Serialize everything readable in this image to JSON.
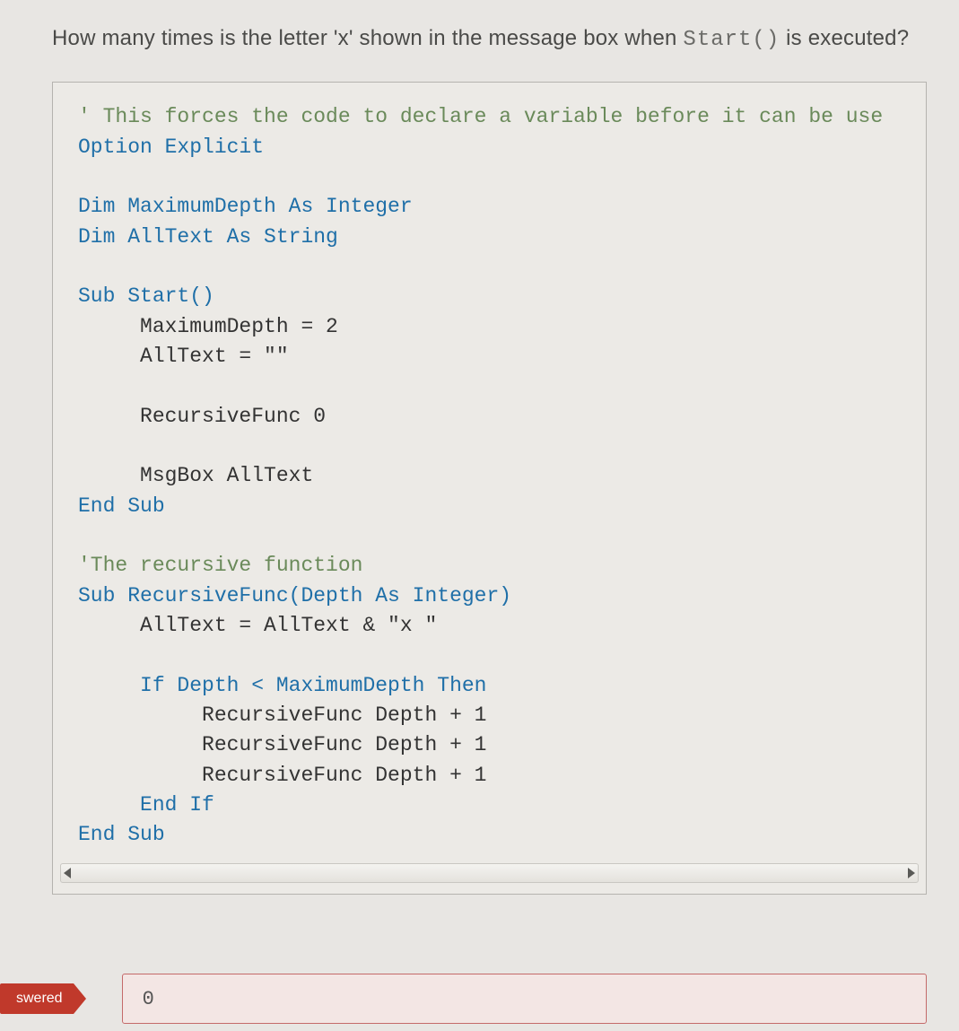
{
  "question": {
    "prefix": "How many times is the letter 'x' shown in the message box when ",
    "code_inline": "Start()",
    "suffix": " is executed?"
  },
  "code": {
    "lines": [
      {
        "indent": 0,
        "cls": "cm",
        "text": "' This forces the code to declare a variable before it can be use"
      },
      {
        "indent": 0,
        "cls": "kw",
        "text": "Option Explicit"
      },
      {
        "indent": 0,
        "cls": "",
        "text": ""
      },
      {
        "indent": 0,
        "cls": "kw",
        "text": "Dim MaximumDepth As Integer"
      },
      {
        "indent": 0,
        "cls": "kw",
        "text": "Dim AllText As String"
      },
      {
        "indent": 0,
        "cls": "",
        "text": ""
      },
      {
        "indent": 0,
        "cls": "kw",
        "text": "Sub Start()"
      },
      {
        "indent": 1,
        "cls": "",
        "text": "MaximumDepth = 2"
      },
      {
        "indent": 1,
        "cls": "",
        "text": "AllText = \"\""
      },
      {
        "indent": 0,
        "cls": "",
        "text": ""
      },
      {
        "indent": 1,
        "cls": "",
        "text": "RecursiveFunc 0"
      },
      {
        "indent": 0,
        "cls": "",
        "text": ""
      },
      {
        "indent": 1,
        "cls": "",
        "text": "MsgBox AllText"
      },
      {
        "indent": 0,
        "cls": "kw",
        "text": "End Sub"
      },
      {
        "indent": 0,
        "cls": "",
        "text": ""
      },
      {
        "indent": 0,
        "cls": "cm",
        "text": "'The recursive function"
      },
      {
        "indent": 0,
        "cls": "kw",
        "text": "Sub RecursiveFunc(Depth As Integer)"
      },
      {
        "indent": 1,
        "cls": "",
        "text": "AllText = AllText & \"x \""
      },
      {
        "indent": 0,
        "cls": "",
        "text": ""
      },
      {
        "indent": 1,
        "cls": "kw",
        "text": "If Depth < MaximumDepth Then"
      },
      {
        "indent": 2,
        "cls": "",
        "text": "RecursiveFunc Depth + 1"
      },
      {
        "indent": 2,
        "cls": "",
        "text": "RecursiveFunc Depth + 1"
      },
      {
        "indent": 2,
        "cls": "",
        "text": "RecursiveFunc Depth + 1"
      },
      {
        "indent": 1,
        "cls": "kw",
        "text": "End If"
      },
      {
        "indent": 0,
        "cls": "kw",
        "text": "End Sub"
      }
    ],
    "indent_unit": "     "
  },
  "flag_label": "swered",
  "answer_value": "0"
}
